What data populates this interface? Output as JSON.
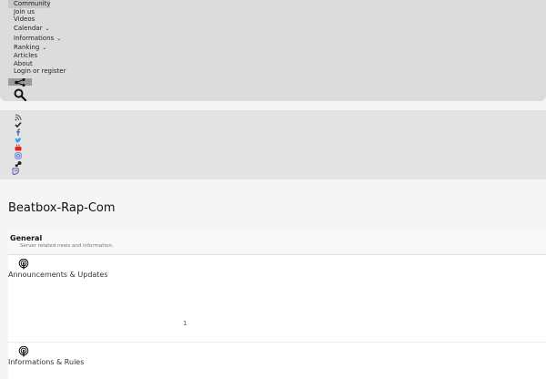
{
  "nav": {
    "items": [
      {
        "label": "Community",
        "chevron": false
      },
      {
        "label": "Join us",
        "chevron": false
      },
      {
        "label": "Videos",
        "chevron": false
      },
      {
        "label": "Calendar",
        "chevron": true
      },
      {
        "label": "Informations",
        "chevron": true
      },
      {
        "label": "Ranking",
        "chevron": true
      },
      {
        "label": "Articles",
        "chevron": false
      },
      {
        "label": "About",
        "chevron": false
      },
      {
        "label": "Login or register",
        "chevron": false
      }
    ],
    "share_icon": "share-icon",
    "search_icon": "search-icon"
  },
  "social": [
    {
      "name": "rss-icon",
      "color": "#555555"
    },
    {
      "name": "check-icon",
      "color": "#222222"
    },
    {
      "name": "facebook-icon",
      "color": "#3b5998"
    },
    {
      "name": "twitter-icon",
      "color": "#1da1f2"
    },
    {
      "name": "youtube-icon",
      "color": "#e62117"
    },
    {
      "name": "instagram-icon",
      "color": "#5b7bd5"
    },
    {
      "name": "steam-icon",
      "color": "#222222"
    },
    {
      "name": "twitch-icon",
      "color": "#6441a5"
    }
  ],
  "site": {
    "title": "Beatbox-Rap-Com"
  },
  "category": {
    "title": "General",
    "description": "Server related news and information."
  },
  "boards": [
    {
      "name": "Announcements & Updates",
      "count": "1"
    },
    {
      "name": "Informations & Rules",
      "count": ""
    }
  ]
}
